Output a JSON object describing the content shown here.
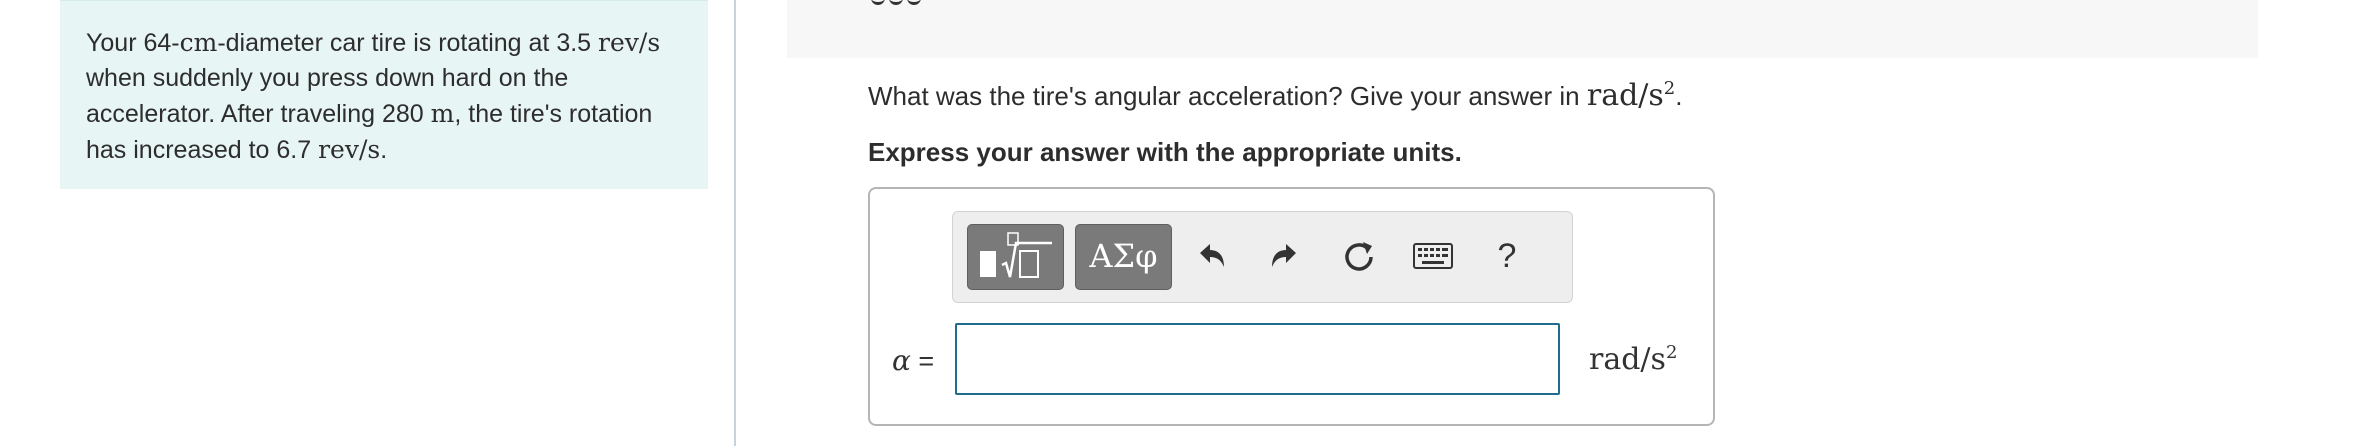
{
  "problem": {
    "p1": "Your 64-",
    "u1": "cm",
    "p2": "-diameter car tire is rotating at 3.5 ",
    "u2": "rev/s",
    "p3": " when suddenly you press down hard on the accelerator. After traveling 280 ",
    "u3": "m",
    "p4": ", the tire's rotation has increased to 6.7 ",
    "u4": "rev/s",
    "p5": "."
  },
  "question": {
    "text": "What was the tire's angular acceleration? Give your answer in ",
    "unit_base": "rad/s",
    "unit_exp": "2",
    "end": "."
  },
  "instruction": "Express your answer with the appropriate units.",
  "toolbar": {
    "greek_label": "ΑΣφ",
    "help_label": "?",
    "icons": [
      "templates-icon",
      "greek-symbols-icon",
      "undo-icon",
      "redo-icon",
      "reset-icon",
      "keyboard-icon",
      "help-icon"
    ]
  },
  "answer": {
    "variable": "α",
    "equals": " =",
    "value": "",
    "unit_base": "rad/s",
    "unit_exp": "2"
  },
  "colors": {
    "problem_bg": "#e7f5f4",
    "toolbar_button": "#7a7a7a",
    "input_border": "#1f6c8e"
  }
}
